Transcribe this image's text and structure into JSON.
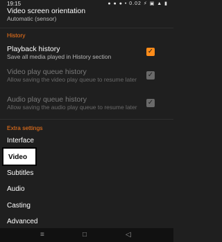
{
  "status": {
    "time": "19:15",
    "icons": "● ● ● • 0.02 ⚡ ▣ ▲ ▮"
  },
  "top_pref": {
    "title": "Video screen orientation",
    "summary": "Automatic (sensor)"
  },
  "history": {
    "header": "History",
    "items": [
      {
        "title": "Playback history",
        "summary": "Save all media played in History section",
        "checked": true,
        "enabled": true
      },
      {
        "title": "Video play queue history",
        "summary": "Allow saving the video play queue to resume later",
        "checked": true,
        "enabled": false
      },
      {
        "title": "Audio play queue history",
        "summary": "Allow saving the audio play queue to resume later",
        "checked": true,
        "enabled": false
      }
    ]
  },
  "extra": {
    "header": "Extra settings",
    "items": [
      "Interface",
      "Video",
      "Subtitles",
      "Audio",
      "Casting",
      "Advanced"
    ]
  },
  "nav": {
    "menu_icon": "menu-icon",
    "home_icon": "home-icon",
    "back_icon": "back-icon"
  },
  "colors": {
    "accent": "#ff8c1a",
    "section": "#ff7a1a",
    "background": "#1f1f1f"
  }
}
